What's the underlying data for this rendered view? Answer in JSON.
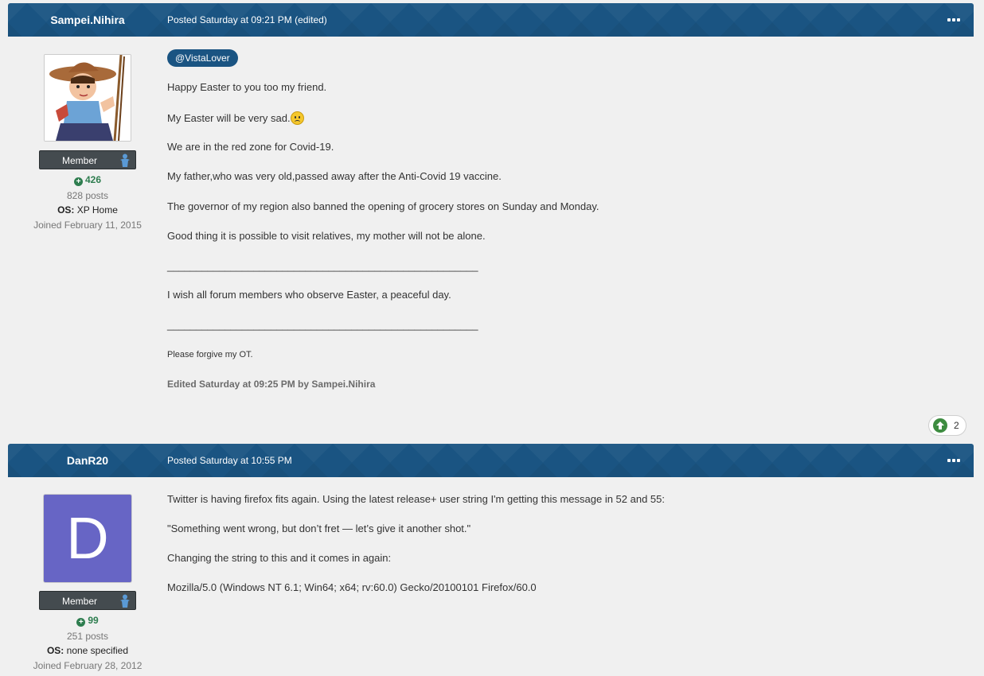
{
  "posts": [
    {
      "author": "Sampei.Nihira",
      "posted": "Posted Saturday at 09:21 PM (edited)",
      "group": "Member",
      "reputation": "426",
      "post_count": "828 posts",
      "os_label": "OS:",
      "os_value": "XP Home",
      "joined": "Joined February 11, 2015",
      "mention": "@VistaLover",
      "lines": [
        "Happy Easter to you too my friend.",
        "My Easter will be very sad.",
        "We are in the red zone for Covid-19.",
        "My father,who was very old,passed away after the Anti-Covid 19 vaccine.",
        "The governor of my region also banned the opening of grocery stores on Sunday and Monday.",
        "Good thing it is possible to visit relatives, my mother will not be alone.",
        "______________________________________________________",
        "I wish all forum members who observe Easter, a peaceful day.",
        "______________________________________________________",
        "Please forgive my OT."
      ],
      "edited": "Edited Saturday at 09:25 PM by Sampei.Nihira",
      "reaction_count": "2"
    },
    {
      "author": "DanR20",
      "posted": "Posted Saturday at 10:55 PM",
      "avatar_letter": "D",
      "group": "Member",
      "reputation": "99",
      "post_count": "251 posts",
      "os_label": "OS:",
      "os_value": "none specified",
      "joined": "Joined February 28, 2012",
      "lines": [
        "Twitter is having firefox fits again. Using the latest release+ user string I'm getting this message in 52 and 55:",
        "\"Something went wrong, but don’t fret — let’s give it another shot.\"",
        "Changing the string to this and it comes in again:",
        "Mozilla/5.0 (Windows NT 6.1; Win64; x64; rv:60.0) Gecko/20100101 Firefox/60.0"
      ]
    }
  ],
  "colors": {
    "header": "#1a5482",
    "badge": "#444b4f",
    "reputation": "#2e7d4f",
    "avatar_letter_bg": "#6765c5"
  }
}
